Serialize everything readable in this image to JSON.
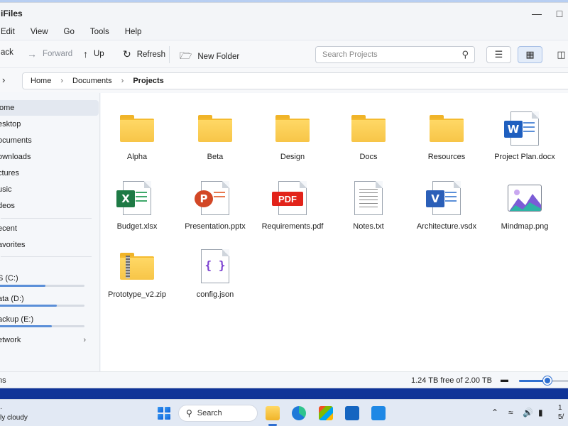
{
  "app": {
    "title": "iFiles"
  },
  "menu": [
    "Edit",
    "View",
    "Go",
    "Tools",
    "Help"
  ],
  "toolbar": {
    "back": "ack",
    "forward": "Forward",
    "up": "Up",
    "refresh": "Refresh",
    "new_folder": "New Folder",
    "search_placeholder": "Search Projects"
  },
  "breadcrumb": {
    "items": [
      "Home",
      "Documents",
      "Projects"
    ]
  },
  "sidebar": {
    "items": [
      "ome",
      "esktop",
      "ocuments",
      "ownloads",
      "ctures",
      "usic",
      "deos"
    ],
    "items2": [
      "ecent",
      "avorites"
    ],
    "drives": [
      {
        "label": "S (C:)",
        "usage": 0.55
      },
      {
        "label": "ata (D:)",
        "usage": 0.68
      },
      {
        "label": "ackup (E:)",
        "usage": 0.62
      }
    ],
    "network": "etwork"
  },
  "files": [
    {
      "name": "Alpha",
      "kind": "folder"
    },
    {
      "name": "Beta",
      "kind": "folder"
    },
    {
      "name": "Design",
      "kind": "folder"
    },
    {
      "name": "Docs",
      "kind": "folder"
    },
    {
      "name": "Resources",
      "kind": "folder"
    },
    {
      "name": "Project Plan.docx",
      "kind": "word"
    },
    {
      "name": "Budget.xlsx",
      "kind": "excel"
    },
    {
      "name": "Presentation.pptx",
      "kind": "powerpoint"
    },
    {
      "name": "Requirements.pdf",
      "kind": "pdf"
    },
    {
      "name": "Notes.txt",
      "kind": "text"
    },
    {
      "name": "Architecture.vsdx",
      "kind": "visio"
    },
    {
      "name": "Mindmap.png",
      "kind": "image"
    },
    {
      "name": "Prototype_v2.zip",
      "kind": "zip"
    },
    {
      "name": "config.json",
      "kind": "json"
    }
  ],
  "status": {
    "items": "ns",
    "free": "1.24 TB free of 2.00 TB",
    "zoom": 0.55
  },
  "taskbar": {
    "weather_line2": "ly cloudy",
    "search_label": "Search",
    "clock_line1": "1",
    "clock_line2": "5/"
  },
  "glyphs": {
    "pdf": "PDF",
    "word": "W",
    "excel": "X",
    "powerpoint": "P",
    "visio": "V",
    "json": "{ }"
  }
}
